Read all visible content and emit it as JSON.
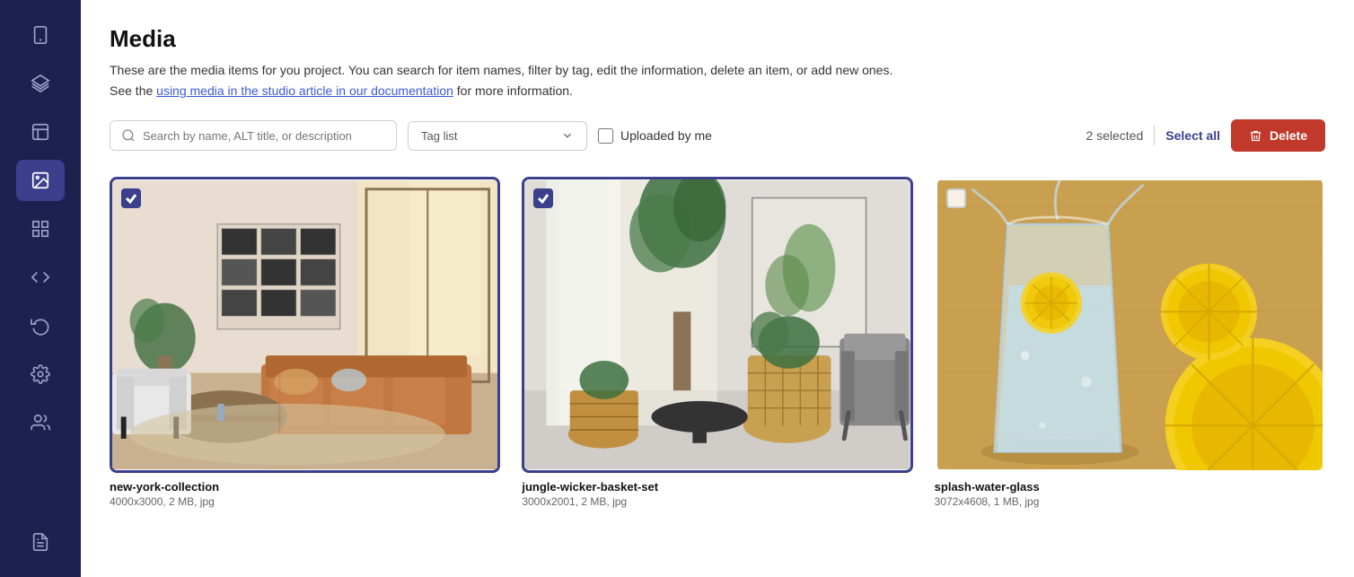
{
  "page": {
    "title": "Media",
    "description": "These are the media items for you project. You can search for item names, filter by tag, edit the information, delete an item, or add new ones.",
    "doc_link_text": "using media in the studio article in our documentation",
    "doc_link_suffix": " for more information.",
    "see_text": "See the"
  },
  "toolbar": {
    "search_placeholder": "Search by name, ALT title, or description",
    "tag_list_label": "Tag list",
    "uploaded_by_me_label": "Uploaded by me",
    "selected_count": "2 selected",
    "select_all_label": "Select all",
    "delete_label": "Delete"
  },
  "media_items": [
    {
      "id": "item-1",
      "name": "new-york-collection",
      "meta": "4000x3000, 2 MB, jpg",
      "selected": true,
      "type": "living-room-1"
    },
    {
      "id": "item-2",
      "name": "jungle-wicker-basket-set",
      "meta": "3000x2001, 2 MB, jpg",
      "selected": true,
      "type": "living-room-2"
    },
    {
      "id": "item-3",
      "name": "splash-water-glass",
      "meta": "3072x4608, 1 MB, jpg",
      "selected": false,
      "type": "lemon-drink"
    }
  ],
  "sidebar": {
    "items": [
      {
        "id": "mobile",
        "icon": "mobile"
      },
      {
        "id": "layers",
        "icon": "layers"
      },
      {
        "id": "layout",
        "icon": "layout"
      },
      {
        "id": "media",
        "icon": "image",
        "active": true
      },
      {
        "id": "grid",
        "icon": "grid"
      },
      {
        "id": "code",
        "icon": "code"
      },
      {
        "id": "undo",
        "icon": "undo"
      },
      {
        "id": "settings",
        "icon": "settings"
      },
      {
        "id": "users",
        "icon": "users"
      },
      {
        "id": "doc",
        "icon": "file-text"
      }
    ]
  }
}
